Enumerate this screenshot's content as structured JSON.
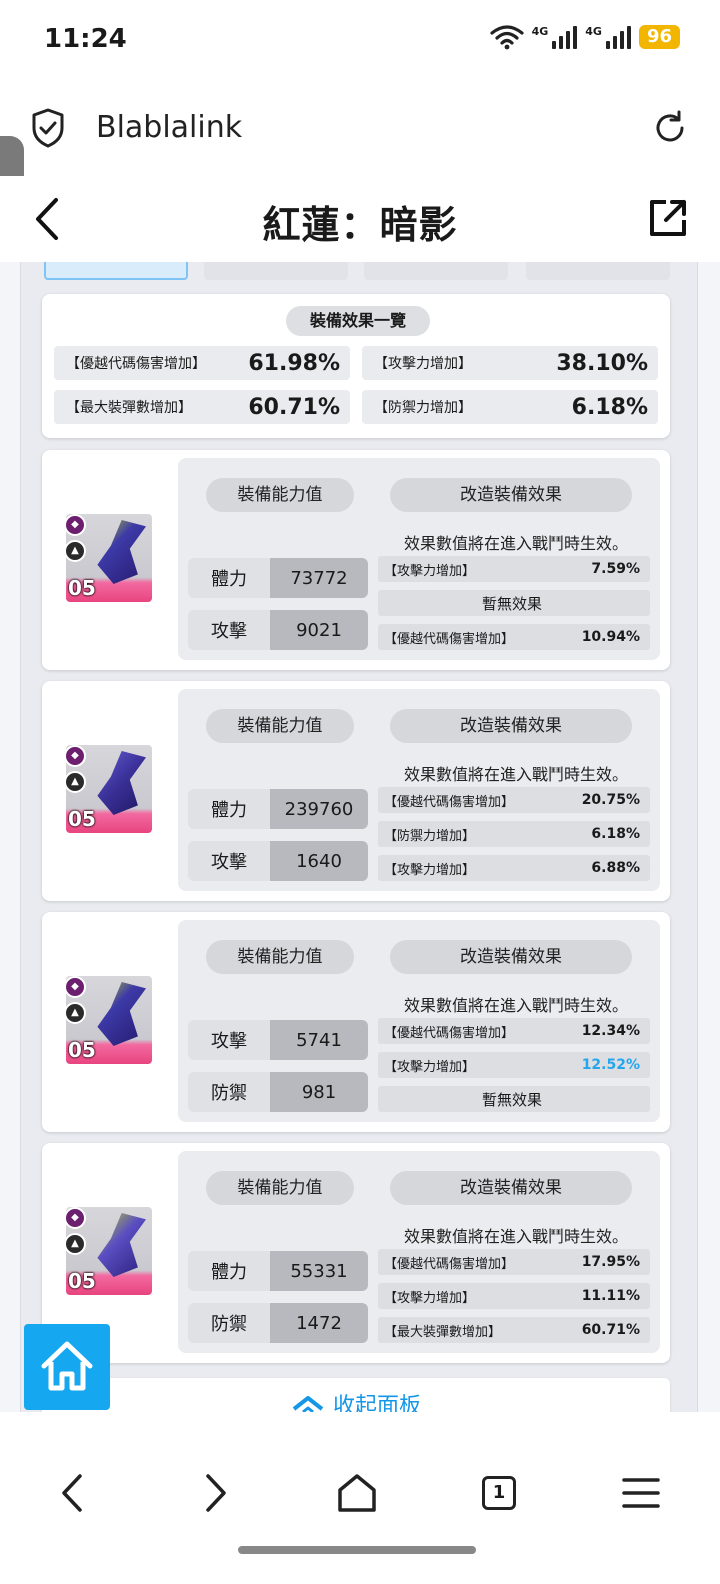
{
  "status_bar": {
    "time": "11:24",
    "network1": "4G",
    "network2": "4G",
    "battery": "96",
    "battery_color": "#f2b600"
  },
  "browser": {
    "site_name": "Blablalink",
    "icons": [
      "shield-check-icon",
      "reload-icon"
    ]
  },
  "header": {
    "title": "紅蓮：暗影",
    "icons": [
      "back-icon",
      "share-icon"
    ]
  },
  "summary": {
    "title": "裝備效果一覽",
    "items": [
      {
        "label": "【優越代碼傷害增加】",
        "value": "61.98%"
      },
      {
        "label": "【攻擊力增加】",
        "value": "38.10%"
      },
      {
        "label": "【最大裝彈數增加】",
        "value": "60.71%"
      },
      {
        "label": "【防禦力增加】",
        "value": "6.18%"
      }
    ]
  },
  "equipment": [
    {
      "level": "05",
      "stats_title": "裝備能力值",
      "mods_title": "改造裝備效果",
      "note": "效果數值將在進入戰鬥時生效。",
      "stats": [
        {
          "label": "體力",
          "value": "73772"
        },
        {
          "label": "攻擊",
          "value": "9021"
        }
      ],
      "effects": [
        {
          "label": "【攻擊力增加】",
          "value": "7.59%"
        },
        {
          "label": "暫無效果",
          "value": ""
        },
        {
          "label": "【優越代碼傷害增加】",
          "value": "10.94%"
        }
      ]
    },
    {
      "level": "05",
      "stats_title": "裝備能力值",
      "mods_title": "改造裝備效果",
      "note": "效果數值將在進入戰鬥時生效。",
      "stats": [
        {
          "label": "體力",
          "value": "239760"
        },
        {
          "label": "攻擊",
          "value": "1640"
        }
      ],
      "effects": [
        {
          "label": "【優越代碼傷害增加】",
          "value": "20.75%"
        },
        {
          "label": "【防禦力增加】",
          "value": "6.18%"
        },
        {
          "label": "【攻擊力增加】",
          "value": "6.88%"
        }
      ]
    },
    {
      "level": "05",
      "stats_title": "裝備能力值",
      "mods_title": "改造裝備效果",
      "note": "效果數值將在進入戰鬥時生效。",
      "stats": [
        {
          "label": "攻擊",
          "value": "5741"
        },
        {
          "label": "防禦",
          "value": "981"
        }
      ],
      "effects": [
        {
          "label": "【優越代碼傷害增加】",
          "value": "12.34%"
        },
        {
          "label": "【攻擊力增加】",
          "value": "12.52%",
          "highlight_color": "#23a6ee"
        },
        {
          "label": "暫無效果",
          "value": ""
        }
      ]
    },
    {
      "level": "05",
      "stats_title": "裝備能力值",
      "mods_title": "改造裝備效果",
      "note": "效果數值將在進入戰鬥時生效。",
      "stats": [
        {
          "label": "體力",
          "value": "55331"
        },
        {
          "label": "防禦",
          "value": "1472"
        }
      ],
      "effects": [
        {
          "label": "【優越代碼傷害增加】",
          "value": "17.95%"
        },
        {
          "label": "【攻擊力增加】",
          "value": "11.11%"
        },
        {
          "label": "【最大裝彈數增加】",
          "value": "60.71%"
        }
      ]
    }
  ],
  "collapse_label": "收起面板",
  "accent_color": "#17a2ef",
  "nav_tab_count": "1"
}
